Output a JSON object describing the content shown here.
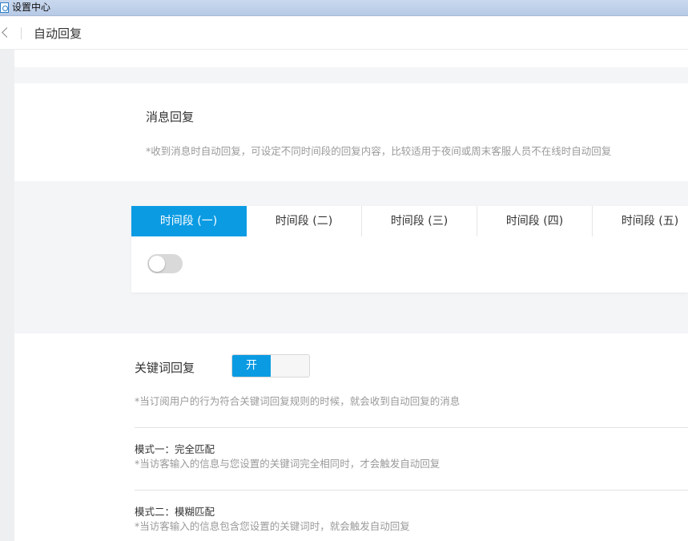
{
  "window": {
    "title": "设置中心",
    "icon": "app-icon"
  },
  "navbar": {
    "back_icon": "chevron-left-icon",
    "title": "自动回复"
  },
  "message_reply": {
    "heading": "消息回复",
    "description": "*收到消息时自动回复，可设定不同时间段的回复内容，比较适用于夜间或周末客服人员不在线时自动回复"
  },
  "time_periods": {
    "tabs": [
      {
        "label": "时间段 (一)",
        "active": true
      },
      {
        "label": "时间段 (二)",
        "active": false
      },
      {
        "label": "时间段 (三)",
        "active": false
      },
      {
        "label": "时间段 (四)",
        "active": false
      },
      {
        "label": "时间段 (五)",
        "active": false
      }
    ],
    "toggle_enabled": false
  },
  "keyword_reply": {
    "heading": "关键词回复",
    "switch_on_label": "开",
    "switch_enabled": true,
    "description": "*当订阅用户的行为符合关键词回复规则的时候，就会收到自动回复的消息",
    "modes": [
      {
        "title": "模式一：完全匹配",
        "description": "*当访客输入的信息与您设置的关键词完全相同时，才会触发自动回复"
      },
      {
        "title": "模式二：模糊匹配",
        "description": "*当访客输入的信息包含您设置的关键词时，就会触发自动回复"
      }
    ]
  },
  "colors": {
    "accent": "#0b9be3",
    "muted_text": "#9a9a9a",
    "background": "#f4f5f7"
  }
}
